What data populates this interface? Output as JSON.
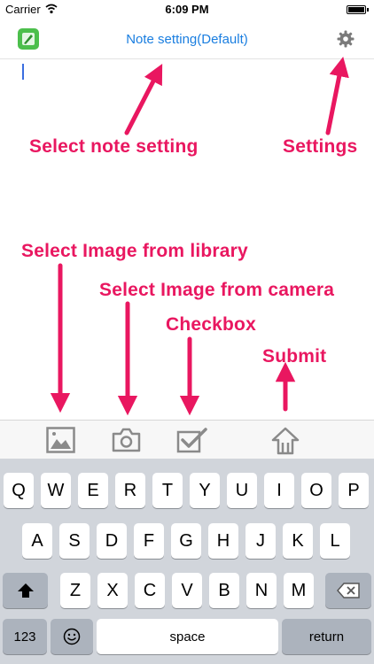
{
  "status_bar": {
    "carrier": "Carrier",
    "time": "6:09 PM"
  },
  "nav": {
    "title": "Note setting(Default)",
    "logo_icon": "note-app-logo-icon",
    "settings_icon": "gear-icon"
  },
  "annotations": {
    "select_note_setting": "Select note setting",
    "settings": "Settings",
    "select_image_library": "Select Image from library",
    "select_image_camera": "Select Image from camera",
    "checkbox": "Checkbox",
    "submit": "Submit"
  },
  "toolbar": {
    "icons": [
      "image-library-icon",
      "camera-icon",
      "checkbox-icon",
      "submit-upload-icon"
    ]
  },
  "keyboard": {
    "row1": [
      "Q",
      "W",
      "E",
      "R",
      "T",
      "Y",
      "U",
      "I",
      "O",
      "P"
    ],
    "row2": [
      "A",
      "S",
      "D",
      "F",
      "G",
      "H",
      "J",
      "K",
      "L"
    ],
    "row3": [
      "Z",
      "X",
      "C",
      "V",
      "B",
      "N",
      "M"
    ],
    "numbers_key": "123",
    "space_key": "space",
    "return_key": "return"
  },
  "colors": {
    "accent": "#1a7ee0",
    "annotation": "#e91760",
    "logo": "#4cbf4c"
  }
}
